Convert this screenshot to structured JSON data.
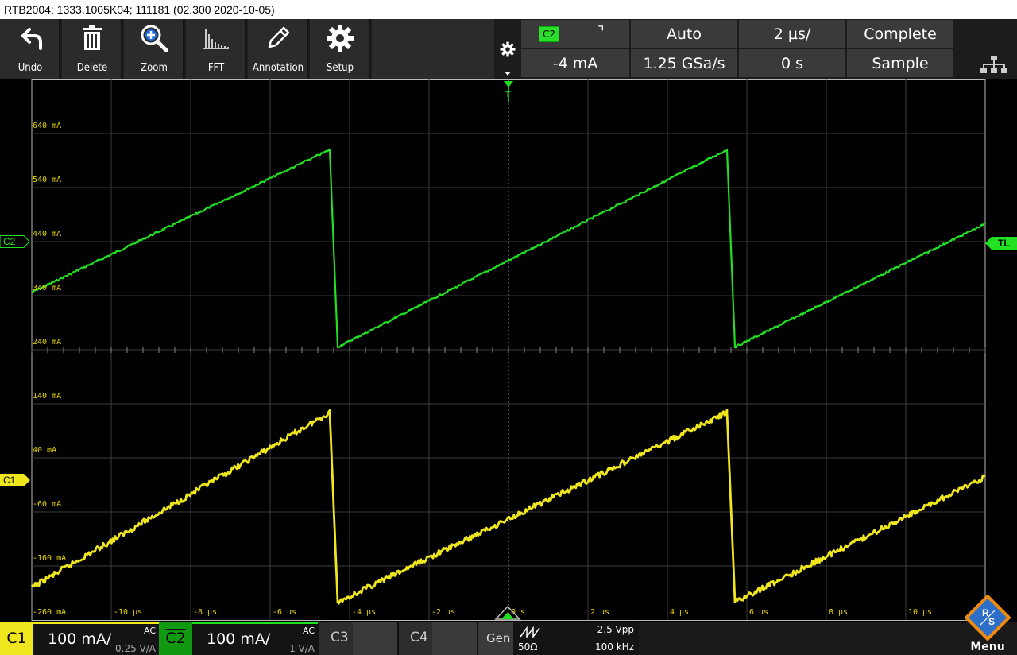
{
  "titlebar": {
    "text": "RTB2004; 1333.1005K04; 111181 (02.300 2020-10-05)"
  },
  "toolbar": {
    "undo_label": "Undo",
    "delete_label": "Delete",
    "zoom_label": "Zoom",
    "fft_label": "FFT",
    "annotation_label": "Annotation",
    "setup_label": "Setup"
  },
  "trigger_info": {
    "source": "C2",
    "slope_symbol": "⌝",
    "mode": "Auto",
    "timebase": "2 µs/",
    "acq_status": "Complete",
    "trigger_level": "-4 mA",
    "sample_rate": "1.25 GSa/s",
    "time_offset": "0 s",
    "acq_mode": "Sample"
  },
  "scale_labels": [
    "640 mA",
    "540 mA",
    "440 mA",
    "340 mA",
    "240 mA",
    "140 mA",
    "40 mA",
    "-60 mA",
    "-160 mA",
    "-260 mA"
  ],
  "time_labels": [
    "-10 µs",
    "-8 µs",
    "-6 µs",
    "-4 µs",
    "-2 µs",
    "0 s",
    "2 µs",
    "4 µs",
    "6 µs",
    "8 µs",
    "10 µs"
  ],
  "markers": {
    "c2": "C2",
    "c1": "C1",
    "trigger_level": "TL",
    "trigger_pos": "T"
  },
  "channels": {
    "c1": {
      "label": "C1",
      "scale": "100 mA/",
      "coupling": "AC",
      "probe": "0.25 V/A"
    },
    "c2": {
      "label": "C2",
      "scale": "100 mA/",
      "coupling": "AC",
      "probe": "1 V/A"
    },
    "c3": {
      "label": "C3"
    },
    "c4": {
      "label": "C4"
    }
  },
  "generator": {
    "label": "Gen",
    "impedance": "50Ω",
    "amplitude": "2.5 Vpp",
    "frequency": "100 kHz"
  },
  "menu": {
    "label": "Menu",
    "logo": "R&S"
  },
  "colors": {
    "c1": "#f0e61e",
    "c2": "#22e022",
    "grid": "#3c3c3c",
    "background": "#000000"
  },
  "chart_data": {
    "type": "line",
    "xlabel": "",
    "ylabel": "",
    "xlim": [
      -12,
      12
    ],
    "series": [
      {
        "name": "C2",
        "x": [
          -12,
          -4.5,
          -4.3,
          5.5,
          5.7,
          12
        ],
        "y": [
          346,
          610,
          245,
          610,
          245,
          473
        ]
      },
      {
        "name": "C1",
        "x": [
          -12,
          -4.5,
          -4.3,
          5.5,
          5.7,
          12
        ],
        "y": [
          -200,
          124,
          -227,
          124,
          -227,
          5
        ]
      }
    ]
  }
}
